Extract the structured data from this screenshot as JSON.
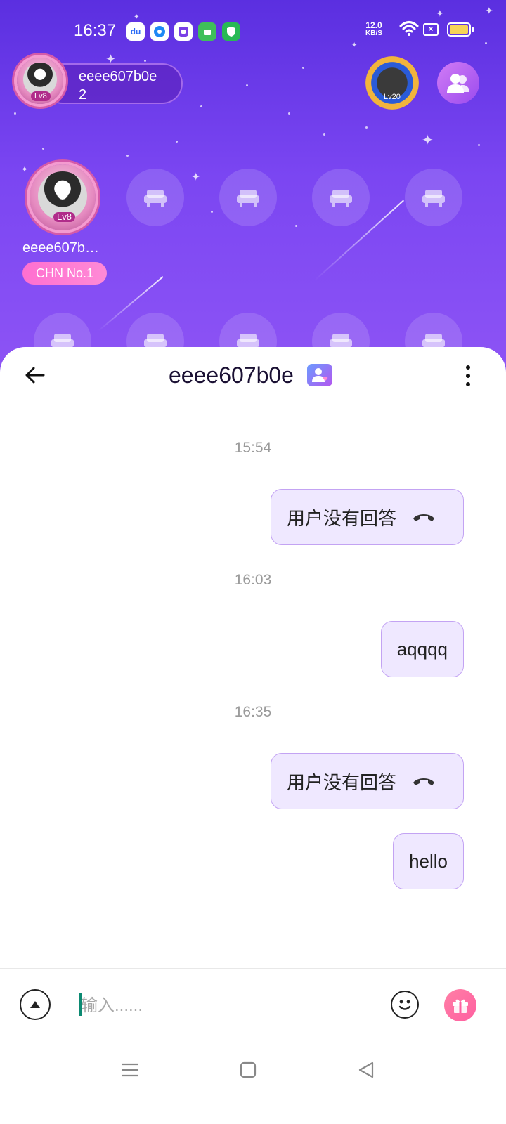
{
  "status_bar": {
    "time": "16:37",
    "net_speed_value": "12.0",
    "net_speed_unit": "KB/S",
    "app_icons": [
      "baidu-icon",
      "browser-icon",
      "app-icon",
      "store-icon",
      "shield-icon"
    ],
    "battery_level": 0.85
  },
  "room": {
    "host": {
      "name": "eeee607b0e",
      "count": "2",
      "level": "Lv8"
    },
    "vip_level": "Lv20",
    "seat_user": {
      "name": "eeee607b…",
      "level": "Lv8",
      "badge": "CHN No.1"
    },
    "empty_seat_count": 9
  },
  "chat": {
    "title": "eeee607b0e",
    "messages": [
      {
        "type": "time",
        "text": "15:54"
      },
      {
        "type": "call",
        "text": "用户没有回答"
      },
      {
        "type": "time",
        "text": "16:03"
      },
      {
        "type": "text",
        "text": "aqqqq"
      },
      {
        "type": "time",
        "text": "16:35"
      },
      {
        "type": "call",
        "text": "用户没有回答"
      },
      {
        "type": "text",
        "text": "hello"
      }
    ]
  },
  "input": {
    "placeholder": "输入......",
    "value": ""
  },
  "colors": {
    "accent": "#7b46f2",
    "bubble_bg": "#efe8ff",
    "bubble_border": "#c3a3f3",
    "badge_pink": "#ff6fd0"
  }
}
